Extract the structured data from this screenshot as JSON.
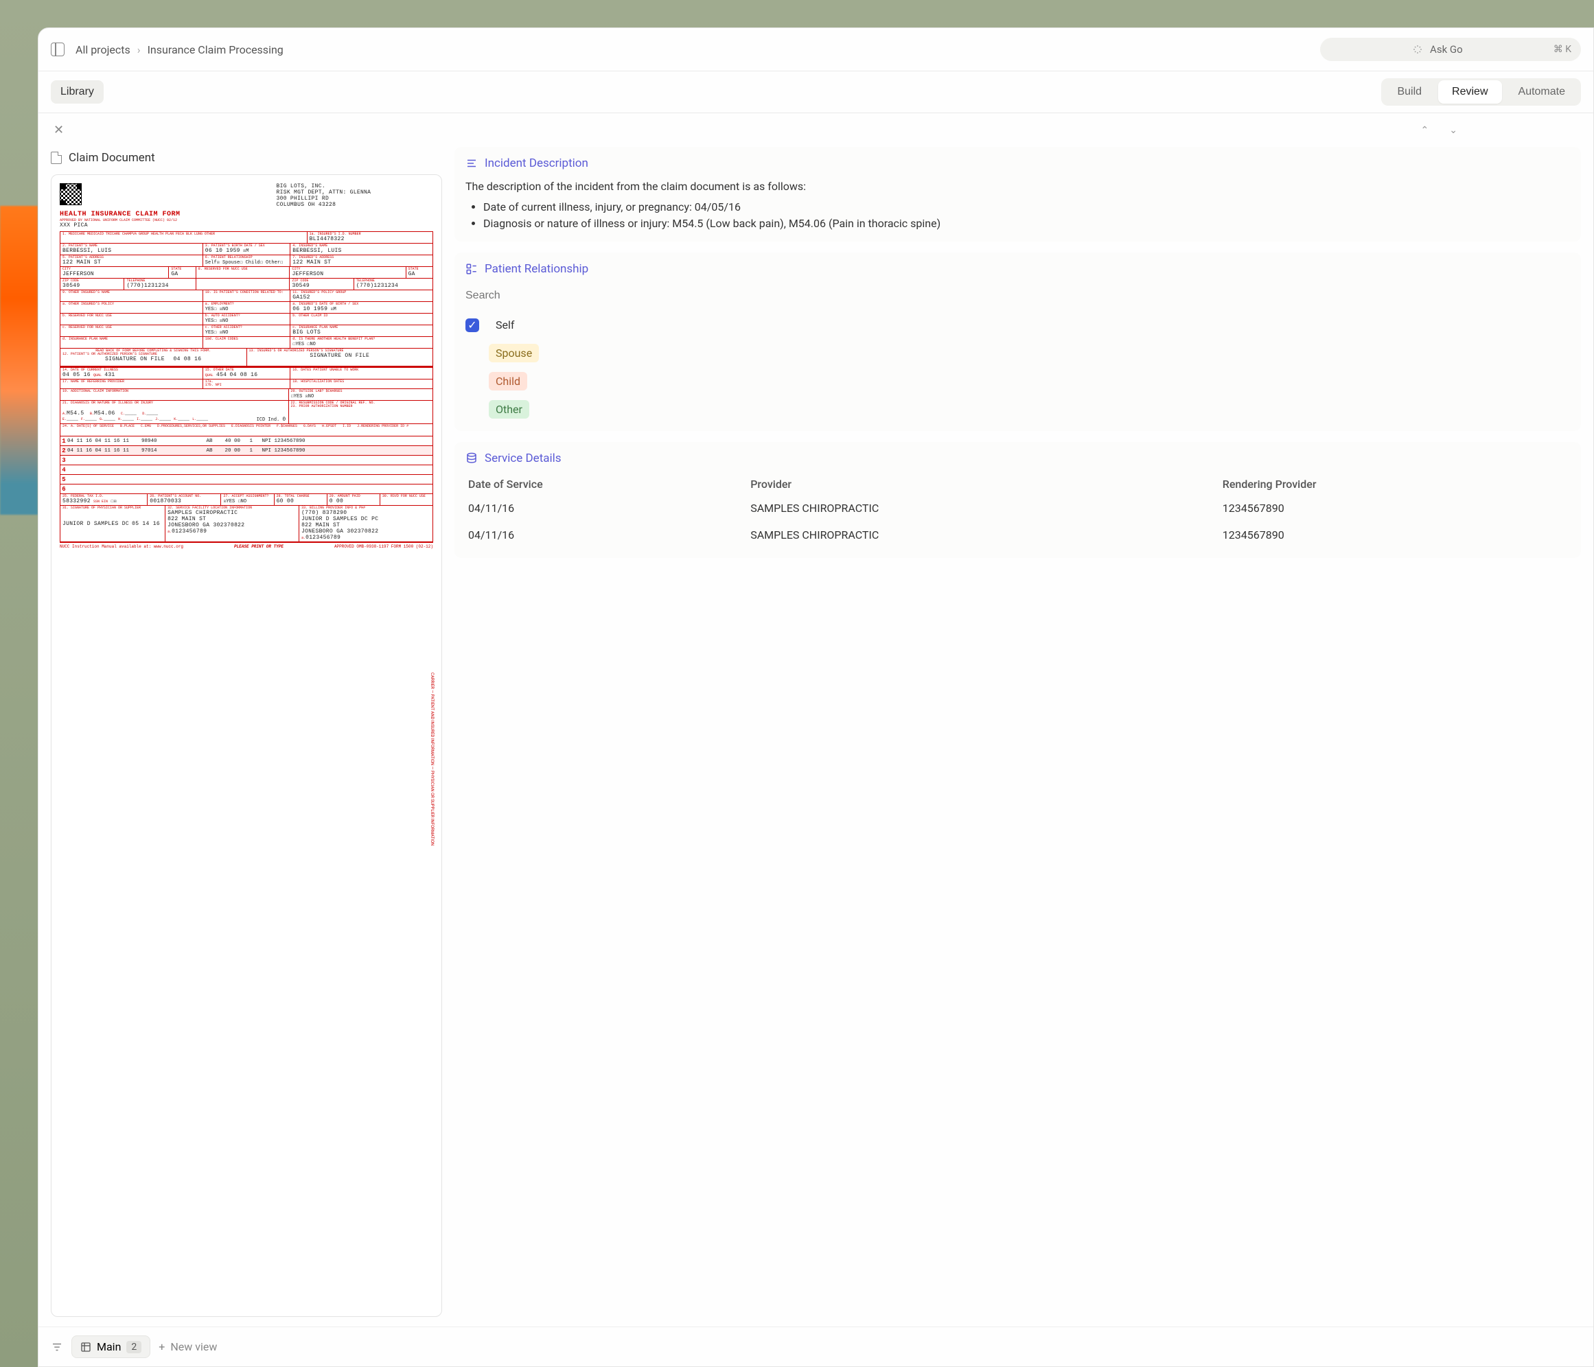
{
  "breadcrumb": {
    "root": "All projects",
    "current": "Insurance Claim Processing"
  },
  "askgo": {
    "placeholder": "Ask Go",
    "shortcut": "⌘  K"
  },
  "library_btn": "Library",
  "tabs": {
    "build": "Build",
    "review": "Review",
    "automate": "Automate"
  },
  "left": {
    "title": "Claim Document",
    "form_title": "HEALTH INSURANCE CLAIM FORM",
    "form_subtitle": "APPROVED BY NATIONAL UNIFORM CLAIM COMMITTEE (NUCC) 02/12",
    "pica": "XXX PICA",
    "carrier": {
      "name": "BIG LOTS, INC.",
      "dept": "RISK MGT DEPT, ATTN: GLENNA",
      "street": "300 PHILLIPI RD",
      "citystate": "COLUMBUS OH 43228"
    },
    "insured_id": "BLI4478322",
    "patient_name": "BERBESSI, LUIS",
    "patient_dob": "06 10 1959",
    "insured_name": "BERBESSI, LUIS",
    "patient_addr": "122 MAIN ST",
    "patient_city": "JEFFERSON",
    "patient_state": "GA",
    "patient_zip": "30549",
    "patient_phone": "(770)1231234",
    "insured_addr": "122 MAIN ST",
    "insured_city": "JEFFERSON",
    "insured_state": "GA",
    "insured_zip": "30549",
    "insured_phone": "(770)1231234",
    "group": "GA152",
    "insured_dob": "06 10 1959",
    "plan_name": "BIG LOTS",
    "sig_on_file": "SIGNATURE ON FILE",
    "sig_date": "04 08 16",
    "illness_date": "04 05 16",
    "qual": "431",
    "other_date": "04 08 16",
    "qual_other": "454",
    "diag1": "M54.5",
    "diag2": "M54.06",
    "icd_ind": "0",
    "services": [
      {
        "n": "1",
        "from": "04 11 16",
        "to": "04 11 16",
        "pos": "11",
        "cpt": "98940",
        "ptr": "AB",
        "charge": "40 00",
        "units": "1",
        "npi": "1234567890"
      },
      {
        "n": "2",
        "from": "04 11 16",
        "to": "04 11 16",
        "pos": "11",
        "cpt": "97014",
        "ptr": "AB",
        "charge": "20 00",
        "units": "1",
        "npi": "1234567890"
      },
      {
        "n": "3"
      },
      {
        "n": "4"
      },
      {
        "n": "5"
      },
      {
        "n": "6"
      }
    ],
    "tax_id": "58332992",
    "acct_no": "001870033",
    "total": "60 00",
    "paid": "0 00",
    "bill_name": "SAMPLES CHIROPRACTIC",
    "bill_addr": "822 MAIN ST",
    "bill_citystate": "JONESBORO GA 302370822",
    "bill_npi": "0123456789",
    "fac_name": "JUNIOR D SAMPLES DC PC",
    "fac_addr": "822 MAIN ST",
    "fac_citystate": "JONESBORO GA 302370822",
    "fac_npi": "0123456789",
    "bill_phone": "(770) 8378290",
    "sig_name": "JUNIOR D SAMPLES DC",
    "sig_date2": "05 14 16",
    "footer_left": "NUCC Instruction Manual available at: www.nucc.org",
    "footer_mid": "PLEASE PRINT OR TYPE",
    "footer_right": "APPROVED OMB-0938-1197 FORM 1500 (02-12)"
  },
  "incident": {
    "title": "Incident Description",
    "intro": "The description of the incident from the claim document is as follows:",
    "b1": "Date of current illness, injury, or pregnancy: 04/05/16",
    "b2": "Diagnosis or nature of illness or injury: M54.5 (Low back pain), M54.06 (Pain in thoracic spine)"
  },
  "relationship": {
    "title": "Patient Relationship",
    "search_placeholder": "Search",
    "self": "Self",
    "spouse": "Spouse",
    "child": "Child",
    "other": "Other"
  },
  "service_details": {
    "title": "Service Details",
    "headers": {
      "date": "Date of Service",
      "provider": "Provider",
      "rendering": "Rendering Provider"
    },
    "rows": [
      {
        "date": "04/11/16",
        "provider": "SAMPLES CHIROPRACTIC",
        "rendering": "1234567890"
      },
      {
        "date": "04/11/16",
        "provider": "SAMPLES CHIROPRACTIC",
        "rendering": "1234567890"
      }
    ]
  },
  "bottom": {
    "main": "Main",
    "main_count": "2",
    "new_view": "New view"
  }
}
